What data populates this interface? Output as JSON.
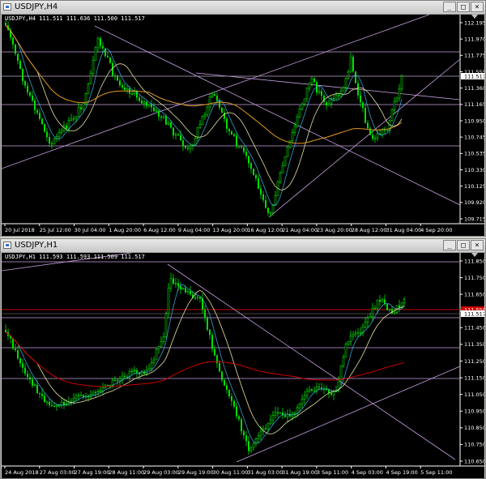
{
  "top_window": {
    "title": "USDJPY,H4",
    "symbol_line": "USDJPY,H4  111.511 111.636 111.500 111.517",
    "price_tag": "111.517",
    "price_labels": [
      "112.195",
      "111.970",
      "111.775",
      "111.555",
      "111.360",
      "111.165",
      "110.950",
      "110.745",
      "110.535",
      "110.330",
      "110.125",
      "109.920",
      "109.715"
    ],
    "time_labels": [
      "20 Jul 2018",
      "25 Jul 12:00",
      "30 Jul 04:00",
      "1 Aug 20:00",
      "6 Aug 12:00",
      "9 Aug 04:00",
      "13 Aug 20:00",
      "16 Aug 12:00",
      "21 Aug 04:00",
      "23 Aug 20:00",
      "28 Aug 12:00",
      "31 Aug 04:00",
      "4 Sep 20:00"
    ]
  },
  "bottom_window": {
    "title": "USDJPY,H1",
    "symbol_line": "USDJPY,H1  111.593 111.593 111.509 111.517",
    "price_tag": "111.517",
    "red_tag": "111.550",
    "price_labels": [
      "111.850",
      "111.750",
      "111.650",
      "111.550",
      "111.450",
      "111.350",
      "111.250",
      "111.150",
      "111.050",
      "110.950",
      "110.850",
      "110.750",
      "110.650"
    ],
    "time_labels": [
      "24 Aug 2018",
      "27 Aug 03:00",
      "27 Aug 19:00",
      "28 Aug 11:00",
      "29 Aug 03:00",
      "29 Aug 19:00",
      "30 Aug 11:00",
      "31 Aug 03:00",
      "31 Aug 19:00",
      "3 Sep 11:00",
      "4 Sep 03:00",
      "4 Sep 19:00",
      "5 Sep 11:00"
    ]
  },
  "window_buttons": {
    "minimize": "_",
    "maximize": "□",
    "close": "×"
  },
  "colors": {
    "bull": "#00e000",
    "bear": "#00e000",
    "grid_line": "#c8a0e0",
    "ma_slow_top": "#e09a20",
    "ma_slow_bottom": "#cc0000",
    "ma_fast": "#e6e2a0"
  }
}
